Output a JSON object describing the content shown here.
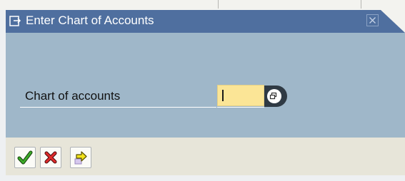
{
  "window": {
    "title": "Enter Chart of Accounts",
    "title_icon": "dialog-arrow-icon",
    "close_icon": "close-icon"
  },
  "form": {
    "label": "Chart of accounts",
    "value": "",
    "search_help_icon": "f4-search-help-icon"
  },
  "footer": {
    "buttons": [
      {
        "name": "continue-button",
        "icon": "checkmark-icon",
        "color": "#2e8b1e"
      },
      {
        "name": "cancel-button",
        "icon": "x-icon",
        "color": "#d22a2a"
      },
      {
        "name": "other-button",
        "icon": "arrow-right-icon",
        "color": "#f2e21a"
      }
    ]
  },
  "colors": {
    "titlebar": "#4f6f9f",
    "content": "#9fb7c9",
    "input": "#fbe596",
    "footer": "#e7e5d9"
  }
}
